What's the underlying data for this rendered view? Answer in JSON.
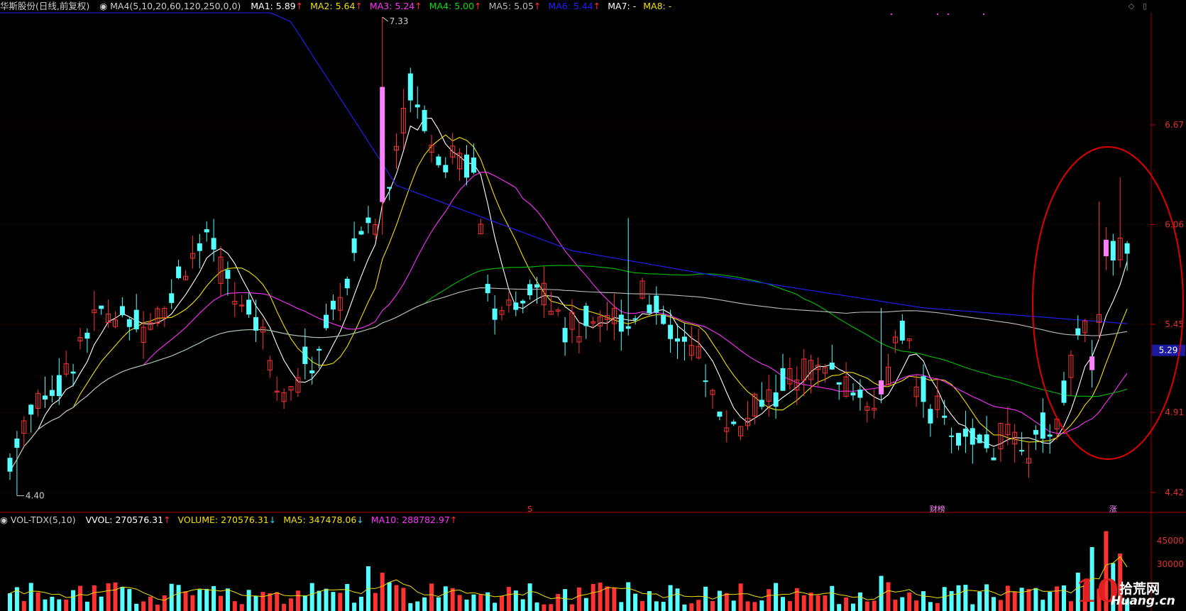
{
  "header": {
    "stock": "华斯股份",
    "mode": "(日线,前复权)",
    "indicator": "MA4(5,10,20,60,120,250,0,0)",
    "ma": [
      {
        "label": "MA1:",
        "value": "5.89",
        "color": "#ffffff",
        "arrow": "↑"
      },
      {
        "label": "MA2:",
        "value": "5.64",
        "color": "#f0e000",
        "arrow": "↑"
      },
      {
        "label": "MA3:",
        "value": "5.24",
        "color": "#ff30ff",
        "arrow": "↑"
      },
      {
        "label": "MA4:",
        "value": "5.00",
        "color": "#00e000",
        "arrow": "↑"
      },
      {
        "label": "MA5:",
        "value": "5.05",
        "color": "#bbbbbb",
        "arrow": "↑"
      },
      {
        "label": "MA6:",
        "value": "5.44",
        "color": "#2020ff",
        "arrow": "↑"
      },
      {
        "label": "MA7:",
        "value": "-",
        "color": "#ffffff",
        "arrow": ""
      },
      {
        "label": "MA8:",
        "value": "-",
        "color": "#f0e000",
        "arrow": ""
      }
    ]
  },
  "vol_header": {
    "indicator": "VOL-TDX(5,10)",
    "items": [
      {
        "label": "VVOL:",
        "value": "270576.31",
        "color": "#ffffff",
        "arrow": "↑",
        "arrow_color": "#ff3232"
      },
      {
        "label": "VOLUME:",
        "value": "270576.31",
        "color": "#f0e000",
        "arrow": "↓",
        "arrow_color": "#2bd6e8"
      },
      {
        "label": "MA5:",
        "value": "347478.06",
        "color": "#f0e000",
        "arrow": "↓",
        "arrow_color": "#2bd6e8"
      },
      {
        "label": "MA10:",
        "value": "288782.97",
        "color": "#ff30ff",
        "arrow": "↑",
        "arrow_color": "#ff3232"
      }
    ]
  },
  "chart_data": {
    "type": "candlestick",
    "price_axis": {
      "ticks": [
        "6.67",
        "6.06",
        "5.45",
        "4.91",
        "4.42"
      ],
      "ticks_num": [
        6.67,
        6.06,
        5.45,
        4.91,
        4.42
      ],
      "current_label": "5.29",
      "current_value": 5.29
    },
    "annotations": {
      "high": "7.33",
      "low": "4.40",
      "markers": [
        "S",
        "财榜",
        "涨"
      ]
    },
    "volume_axis": {
      "ticks": [
        "45000",
        "30000"
      ],
      "ticks_num": [
        45000,
        30000
      ]
    },
    "highlight": "last rally circled in red",
    "colors": {
      "up": "#ff3232",
      "down": "#54ffff",
      "ma5": "#ffffff",
      "ma10": "#f0e000",
      "ma20": "#ff30ff",
      "ma60": "#00c000",
      "ma120": "#bbbbbb",
      "ma250": "#2020ff"
    }
  },
  "watermark": {
    "num": "10",
    "top": "拾荒网",
    "bottom": "Huang.cn"
  }
}
